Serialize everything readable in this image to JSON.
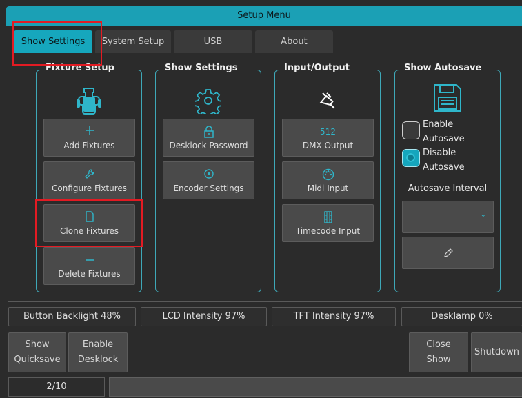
{
  "window": {
    "title": "Setup Menu"
  },
  "tabs": [
    {
      "label": "Show Settings",
      "active": true
    },
    {
      "label": "System Setup",
      "active": false
    },
    {
      "label": "USB",
      "active": false
    },
    {
      "label": "About",
      "active": false
    }
  ],
  "panels": {
    "fixture_setup": {
      "title": "Fixture Setup",
      "icon": "fixture-icon",
      "buttons": [
        {
          "label": "Add Fixtures",
          "icon": "plus-icon"
        },
        {
          "label": "Configure Fixtures",
          "icon": "wrench-icon"
        },
        {
          "label": "Clone Fixtures",
          "icon": "document-icon"
        },
        {
          "label": "Delete Fixtures",
          "icon": "minus-icon"
        }
      ]
    },
    "show_settings": {
      "title": "Show Settings",
      "icon": "gear-icon",
      "buttons": [
        {
          "label": "Desklock Password",
          "icon": "lock-icon"
        },
        {
          "label": "Encoder Settings",
          "icon": "encoder-icon"
        }
      ]
    },
    "input_output": {
      "title": "Input/Output",
      "icon": "plug-icon",
      "buttons": [
        {
          "label": "DMX Output",
          "icon_text": "512"
        },
        {
          "label": "Midi Input",
          "icon": "midi-icon"
        },
        {
          "label": "Timecode Input",
          "icon": "film-icon"
        }
      ]
    },
    "show_autosave": {
      "title": "Show Autosave",
      "icon": "floppy-disk-icon",
      "enable_label_1": "Enable",
      "enable_label_2": "Autosave",
      "disable_label_1": "Disable",
      "disable_label_2": "Autosave",
      "selected": "disable",
      "interval_label": "Autosave Interval",
      "interval_value": ""
    }
  },
  "status_bar": [
    {
      "label": "Button Backlight 48%"
    },
    {
      "label": "LCD Intensity 97%"
    },
    {
      "label": "TFT Intensity 97%"
    },
    {
      "label": "Desklamp 0%"
    }
  ],
  "bottom_buttons": {
    "show_quicksave_1": "Show",
    "show_quicksave_2": "Quicksave",
    "enable_desklock_1": "Enable",
    "enable_desklock_2": "Desklock",
    "close_show_1": "Close",
    "close_show_2": "Show",
    "shutdown": "Shutdown"
  },
  "pager": {
    "page": "2/10"
  },
  "colors": {
    "accent": "#1ba0b5",
    "highlight": "#e31b23",
    "panel_border": "#3ea8b8"
  }
}
